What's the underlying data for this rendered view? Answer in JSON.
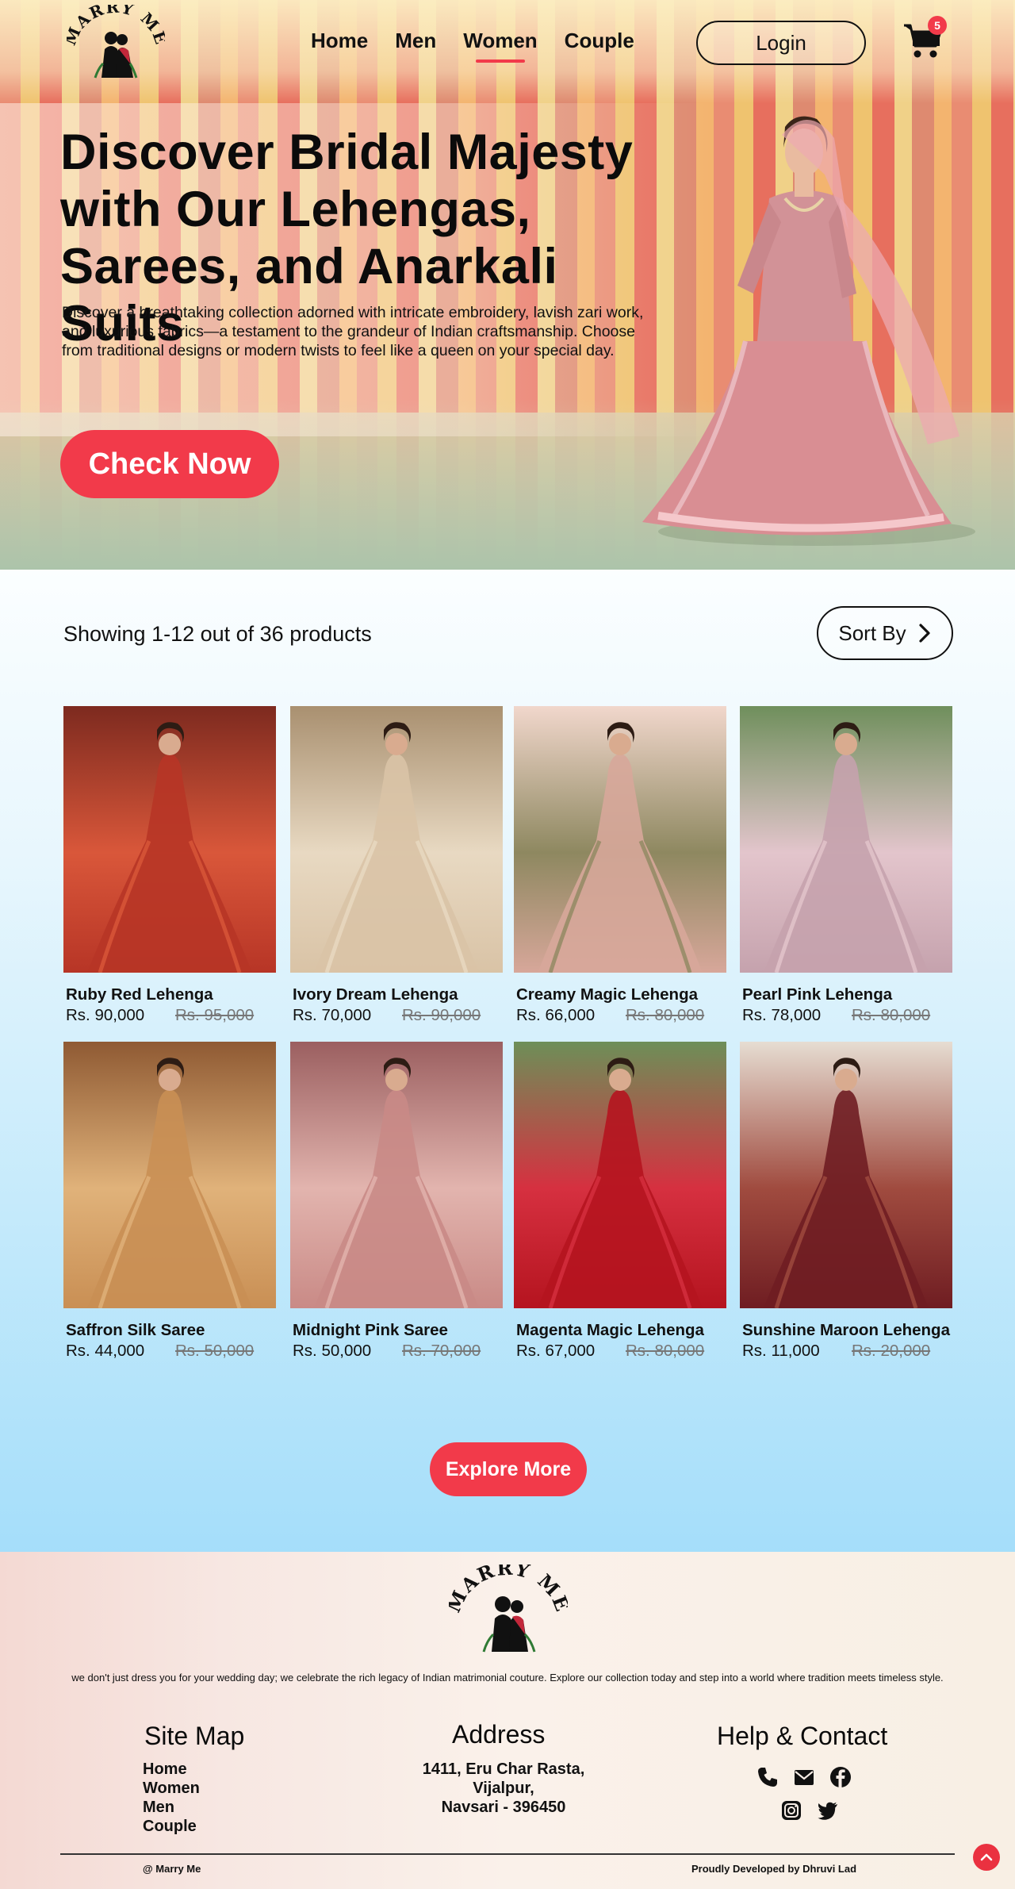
{
  "header": {
    "logo_text": "MARRY ME",
    "nav": [
      {
        "label": "Home",
        "active": false
      },
      {
        "label": "Men",
        "active": false
      },
      {
        "label": "Women",
        "active": true
      },
      {
        "label": "Couple",
        "active": false
      }
    ],
    "login_label": "Login",
    "cart_count": "5",
    "accent_color": "#f23a4a"
  },
  "hero": {
    "title": "Discover Bridal Majesty with Our Lehengas, Sarees, and Anarkali Suits",
    "description": "Discover a breathtaking collection adorned with intricate embroidery, lavish zari work, and luxurious fabrics—a testament to the grandeur of Indian craftsmanship. Choose from traditional designs or modern twists to feel like a queen on your special day.",
    "cta_label": "Check Now"
  },
  "catalog": {
    "showing_text": "Showing 1-12 out of 36 products",
    "sort_label": "Sort By",
    "products": [
      {
        "name": "Ruby Red Lehenga",
        "price": "Rs. 90,000",
        "old_price": "Rs. 95,000",
        "colors": [
          "#b73526",
          "#d9573a",
          "#7d2a1f"
        ]
      },
      {
        "name": "Ivory Dream Lehenga",
        "price": "Rs. 70,000",
        "old_price": "Rs. 90,000",
        "colors": [
          "#d9c3a6",
          "#e8d9c2",
          "#a99070"
        ]
      },
      {
        "name": "Creamy Magic Lehenga",
        "price": "Rs. 66,000",
        "old_price": "Rs. 80,000",
        "colors": [
          "#d7a79a",
          "#8e8860",
          "#f1d7cc"
        ]
      },
      {
        "name": "Pearl Pink Lehenga",
        "price": "Rs. 78,000",
        "old_price": "Rs. 80,000",
        "colors": [
          "#c5a2ad",
          "#e3c5cc",
          "#6f8f5c"
        ]
      },
      {
        "name": "Saffron Silk Saree",
        "price": "Rs. 44,000",
        "old_price": "Rs. 50,000",
        "colors": [
          "#c98f54",
          "#e0b27a",
          "#8f5a33"
        ]
      },
      {
        "name": "Midnight Pink Saree",
        "price": "Rs. 50,000",
        "old_price": "Rs. 70,000",
        "colors": [
          "#c98a86",
          "#e2b4ae",
          "#9b5f60"
        ]
      },
      {
        "name": "Magenta Magic Lehenga",
        "price": "Rs. 67,000",
        "old_price": "Rs. 80,000",
        "colors": [
          "#b5141f",
          "#d63040",
          "#6d8f58"
        ]
      },
      {
        "name": "Sunshine Maroon Lehenga",
        "price": "Rs. 11,000",
        "old_price": "Rs. 20,000",
        "colors": [
          "#6f1d22",
          "#a04b3f",
          "#e6ddd2"
        ]
      }
    ],
    "explore_label": "Explore More"
  },
  "footer": {
    "logo_text": "MARRY ME",
    "blurb": "we don't just dress you for your wedding day; we celebrate the rich legacy of Indian matrimonial couture. Explore our collection today and step into a world where tradition meets timeless style.",
    "sitemap_title": "Site Map",
    "sitemap_links": [
      "Home",
      "Women",
      "Men",
      "Couple"
    ],
    "address_title": "Address",
    "address_lines": [
      "1411, Eru Char Rasta,",
      "Vijalpur,",
      "Navsari - 396450"
    ],
    "contact_title": "Help & Contact",
    "social_icons": [
      "phone-icon",
      "mail-icon",
      "facebook-icon",
      "instagram-icon",
      "twitter-icon"
    ],
    "copyright": "@ Marry Me",
    "credit": "Proudly Developed by Dhruvi Lad"
  }
}
